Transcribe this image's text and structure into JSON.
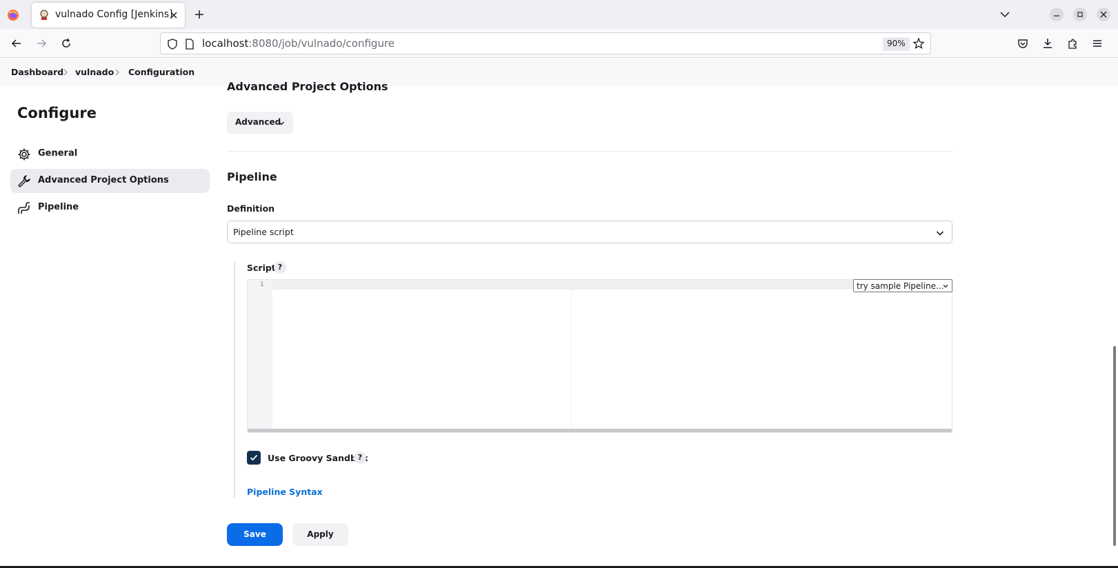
{
  "browser": {
    "tab_title": "vulnado Config [Jenkins]",
    "url_host": "localhost",
    "url_rest": ":8080/job/vulnado/configure",
    "zoom": "90%"
  },
  "breadcrumb": {
    "items": [
      "Dashboard",
      "vulnado",
      "Configuration"
    ]
  },
  "sidebar": {
    "title": "Configure",
    "items": [
      {
        "label": "General",
        "icon": "gear-icon",
        "active": false
      },
      {
        "label": "Advanced Project Options",
        "icon": "wrench-icon",
        "active": true
      },
      {
        "label": "Pipeline",
        "icon": "pipeline-icon",
        "active": false
      }
    ]
  },
  "main": {
    "advanced_section_title": "Advanced Project Options",
    "advanced_button": "Advanced",
    "pipeline_title": "Pipeline",
    "definition_label": "Definition",
    "definition_value": "Pipeline script",
    "script_label": "Script",
    "help_glyph": "?",
    "line_number": "1",
    "sample_select": "try sample Pipeline...",
    "groovy_sandbox_label": "Use Groovy Sandbox",
    "groovy_sandbox_checked": true,
    "pipeline_syntax_link": "Pipeline Syntax",
    "save_label": "Save",
    "apply_label": "Apply"
  },
  "colors": {
    "primary_button": "#0b6ce8",
    "checkbox": "#14304e",
    "link": "#0b6fd6"
  }
}
